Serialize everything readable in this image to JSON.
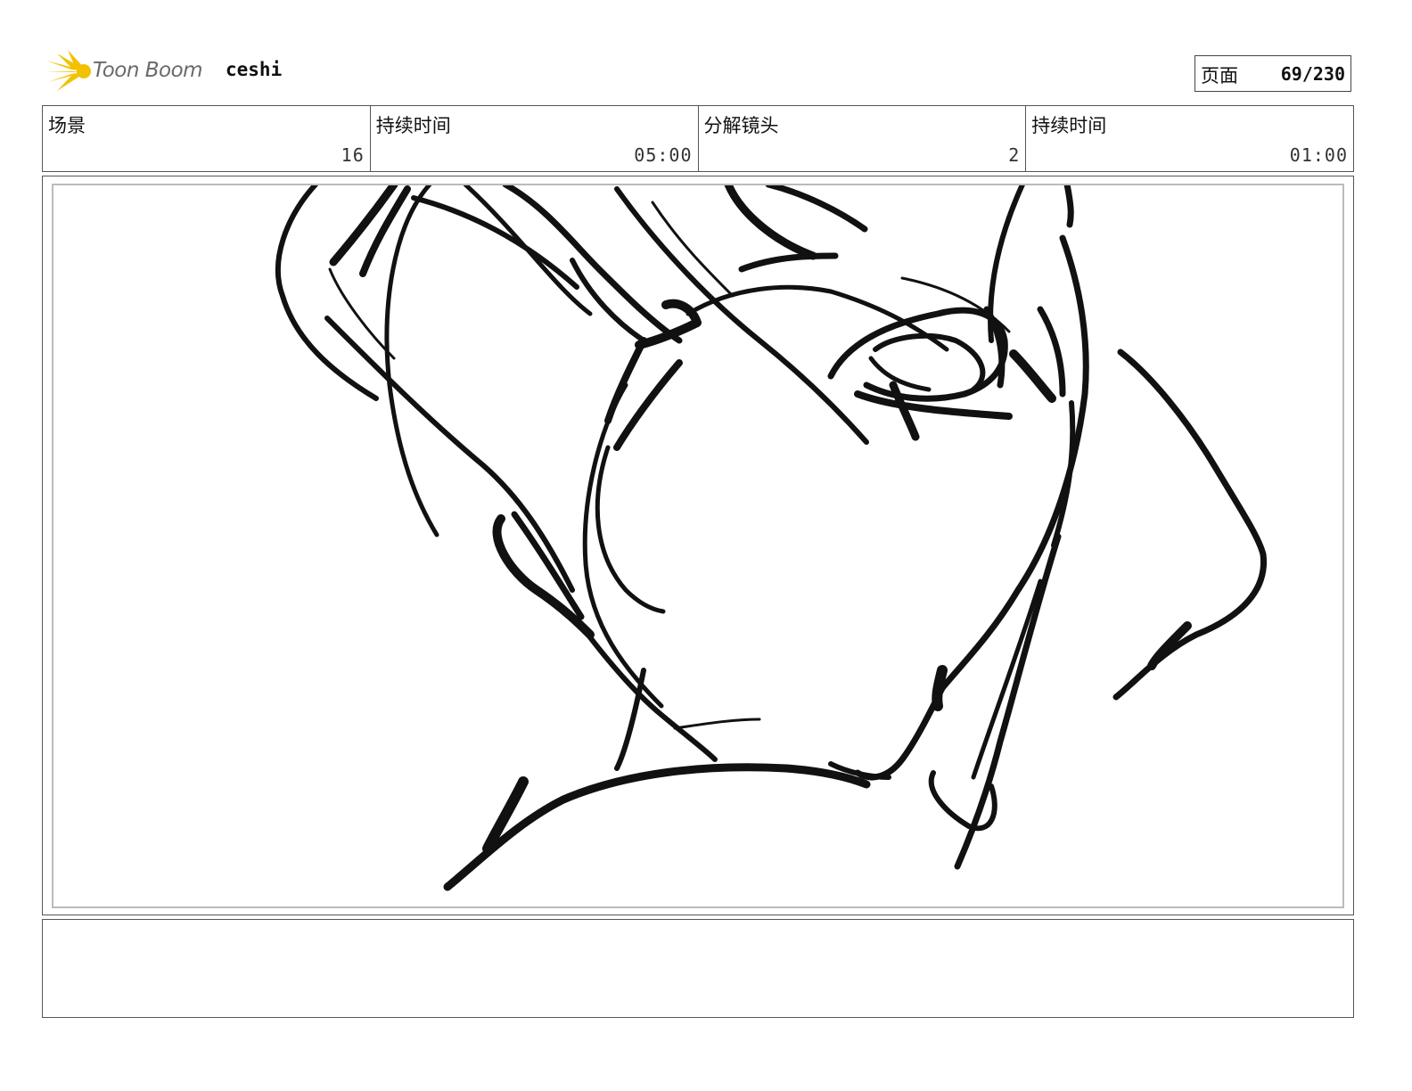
{
  "header": {
    "logo_text": "Toon Boom",
    "project_name": "ceshi",
    "page_label": "页面",
    "page_value": "69/230"
  },
  "info": [
    {
      "label": "场景",
      "value": "16"
    },
    {
      "label": "持续时间",
      "value": "05:00"
    },
    {
      "label": "分解镜头",
      "value": "2"
    },
    {
      "label": "持续时间",
      "value": "01:00"
    }
  ],
  "colors": {
    "logo_accent": "#f2c200",
    "ink": "#111111"
  },
  "icons": {
    "logo": "toon-boom-star-icon"
  }
}
